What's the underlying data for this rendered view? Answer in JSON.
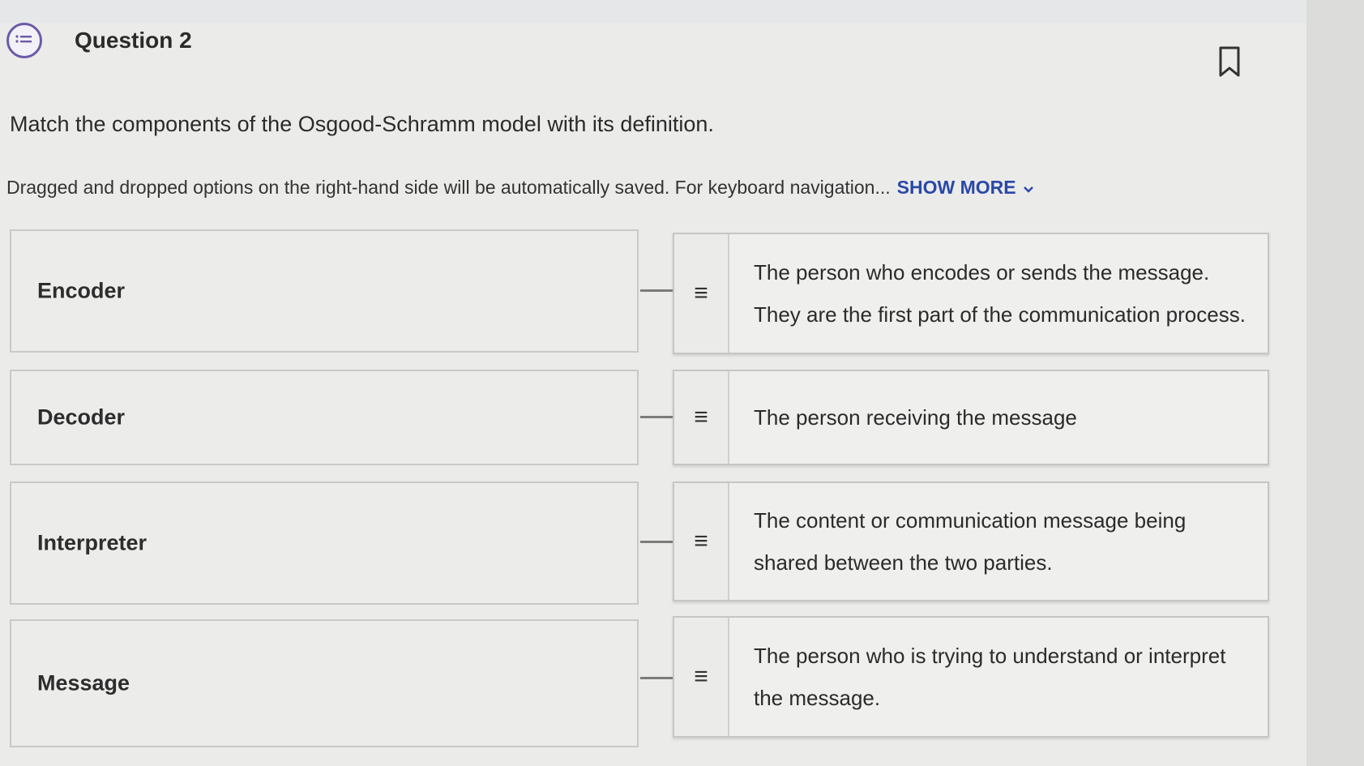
{
  "question": {
    "title": "Question 2",
    "prompt": "Match the components of the Osgood-Schramm model with its definition.",
    "helper_text": "Dragged and dropped options on the right-hand side will be automatically saved. For keyboard navigation...",
    "show_more_label": "SHOW MORE",
    "icon": "question-bubble-icon",
    "bookmark_icon": "bookmark-icon"
  },
  "matching": {
    "terms": [
      "Encoder",
      "Decoder",
      "Interpreter",
      "Message"
    ],
    "definitions": [
      "The person who encodes or sends the message. They are the first part of the communication process.",
      "The person receiving the message",
      "The content or communication message being shared between the two parties.",
      "The person who is trying to understand or interpret the message."
    ],
    "handle_glyph": "≡"
  },
  "colors": {
    "accent": "#6b5aa5",
    "link": "#2a48a8",
    "background": "#ebebea"
  }
}
